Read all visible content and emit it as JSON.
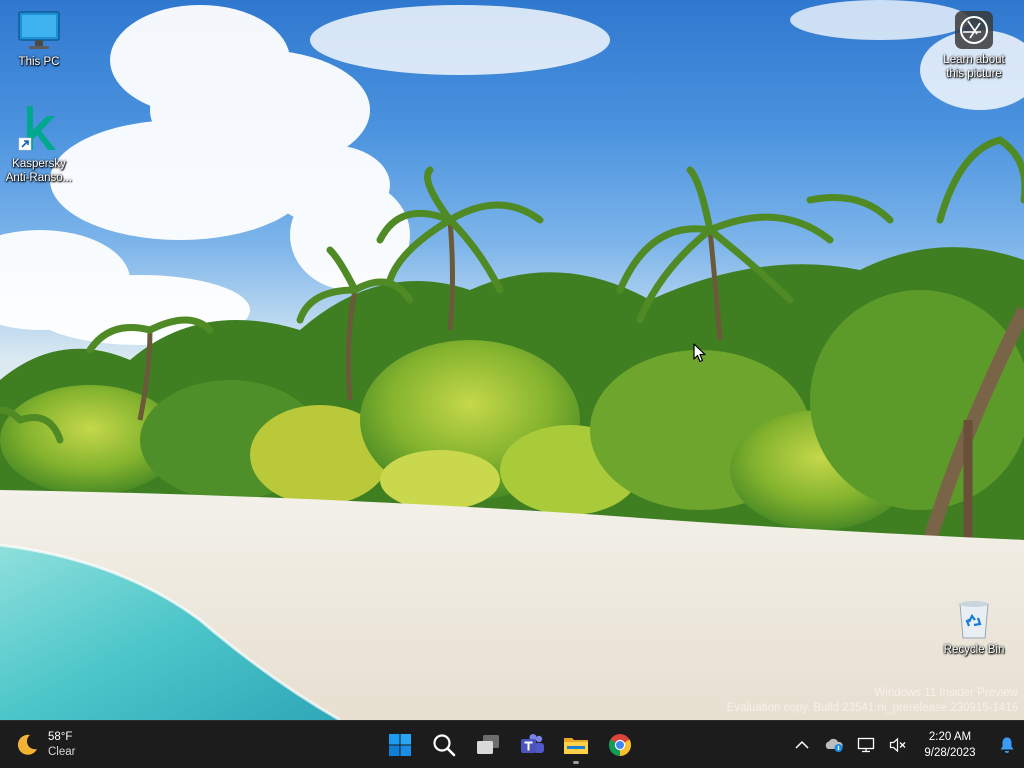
{
  "desktop": {
    "icons": [
      {
        "label": "This PC",
        "icon": "monitor-icon"
      },
      {
        "label": "Kaspersky Anti-Ranso...",
        "icon": "kaspersky-k-icon"
      },
      {
        "label": "Learn about this picture",
        "icon": "camera-icon"
      },
      {
        "label": "Recycle Bin",
        "icon": "recycle-bin-icon"
      }
    ],
    "watermark": {
      "line1": "Windows 11 Insider Preview",
      "line2": "Evaluation copy. Build 23541.ni_prerelease.230915-1416"
    }
  },
  "taskbar": {
    "weather": {
      "temp": "58°F",
      "condition": "Clear",
      "icon": "moon-icon"
    },
    "apps": [
      {
        "name": "Start",
        "icon": "windows-start-icon"
      },
      {
        "name": "Search",
        "icon": "search-icon"
      },
      {
        "name": "Task View",
        "icon": "task-view-icon"
      },
      {
        "name": "Microsoft Teams",
        "icon": "teams-icon"
      },
      {
        "name": "File Explorer",
        "icon": "file-explorer-icon"
      },
      {
        "name": "Google Chrome",
        "icon": "chrome-icon"
      }
    ],
    "tray": {
      "icons": [
        "chevron-up-icon",
        "onedrive-icon",
        "network-icon",
        "speaker-muted-icon"
      ],
      "time": "2:20 AM",
      "date": "9/28/2023",
      "notification_icon": "bell-icon"
    }
  },
  "colors": {
    "taskbar_bg": "#1c1c1c",
    "start_blue": "#0078d4",
    "kaspersky_green": "#00a88e"
  }
}
